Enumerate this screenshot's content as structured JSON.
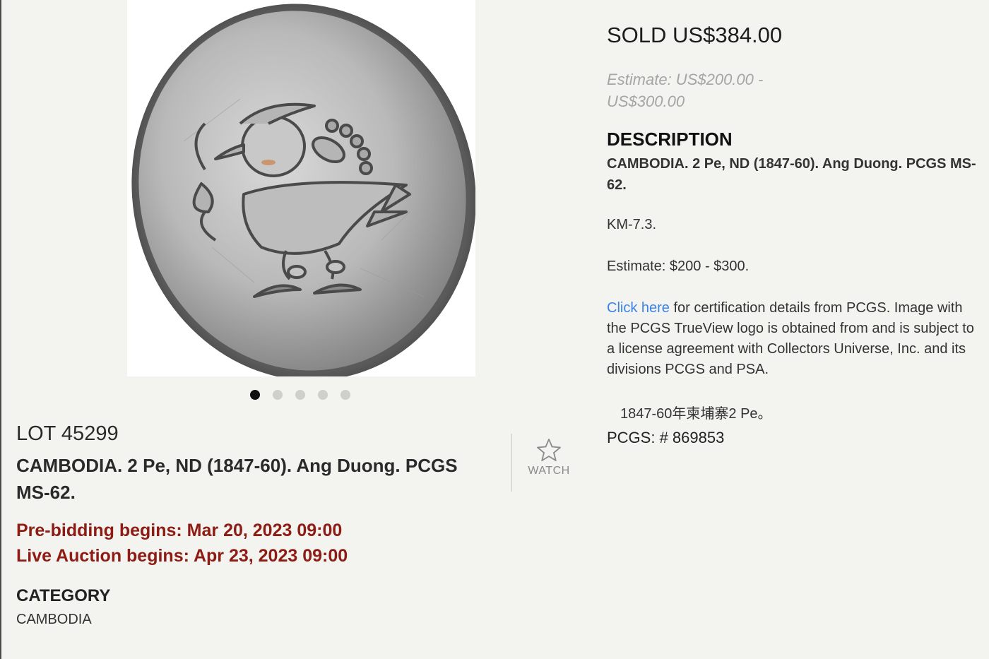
{
  "lot": {
    "number": "LOT 45299",
    "title": "CAMBODIA. 2 Pe, ND (1847-60). Ang Duong. PCGS MS-62.",
    "prebid": "Pre-bidding begins: Mar 20, 2023 09:00",
    "live": "Live Auction begins: Apr 23, 2023 09:00",
    "category_heading": "CATEGORY",
    "category_value": "CAMBODIA",
    "watch_label": "WATCH"
  },
  "carousel": {
    "total": 5,
    "active_index": 0
  },
  "sale": {
    "sold": "SOLD US$384.00",
    "estimate": "Estimate: US$200.00 - US$300.00"
  },
  "description": {
    "heading": "DESCRIPTION",
    "title": "CAMBODIA. 2 Pe, ND (1847-60). Ang Duong. PCGS MS-62.",
    "km": "KM-7.3.",
    "estimate": "Estimate: $200 - $300.",
    "cert_link": "Click here",
    "cert_text": " for certification details from PCGS. Image with the PCGS TrueView logo is obtained from and is subject to a license agreement with Collectors Universe, Inc. and its divisions PCGS and PSA.",
    "chinese": "1847-60年柬埔寨2 Pe。",
    "pcgs_number": "PCGS: # 869853"
  },
  "colors": {
    "accent_red": "#8e1b14",
    "link_blue": "#3b82e8",
    "background": "#f3f3ef"
  },
  "icons": {
    "watch": "star-outline-icon"
  }
}
